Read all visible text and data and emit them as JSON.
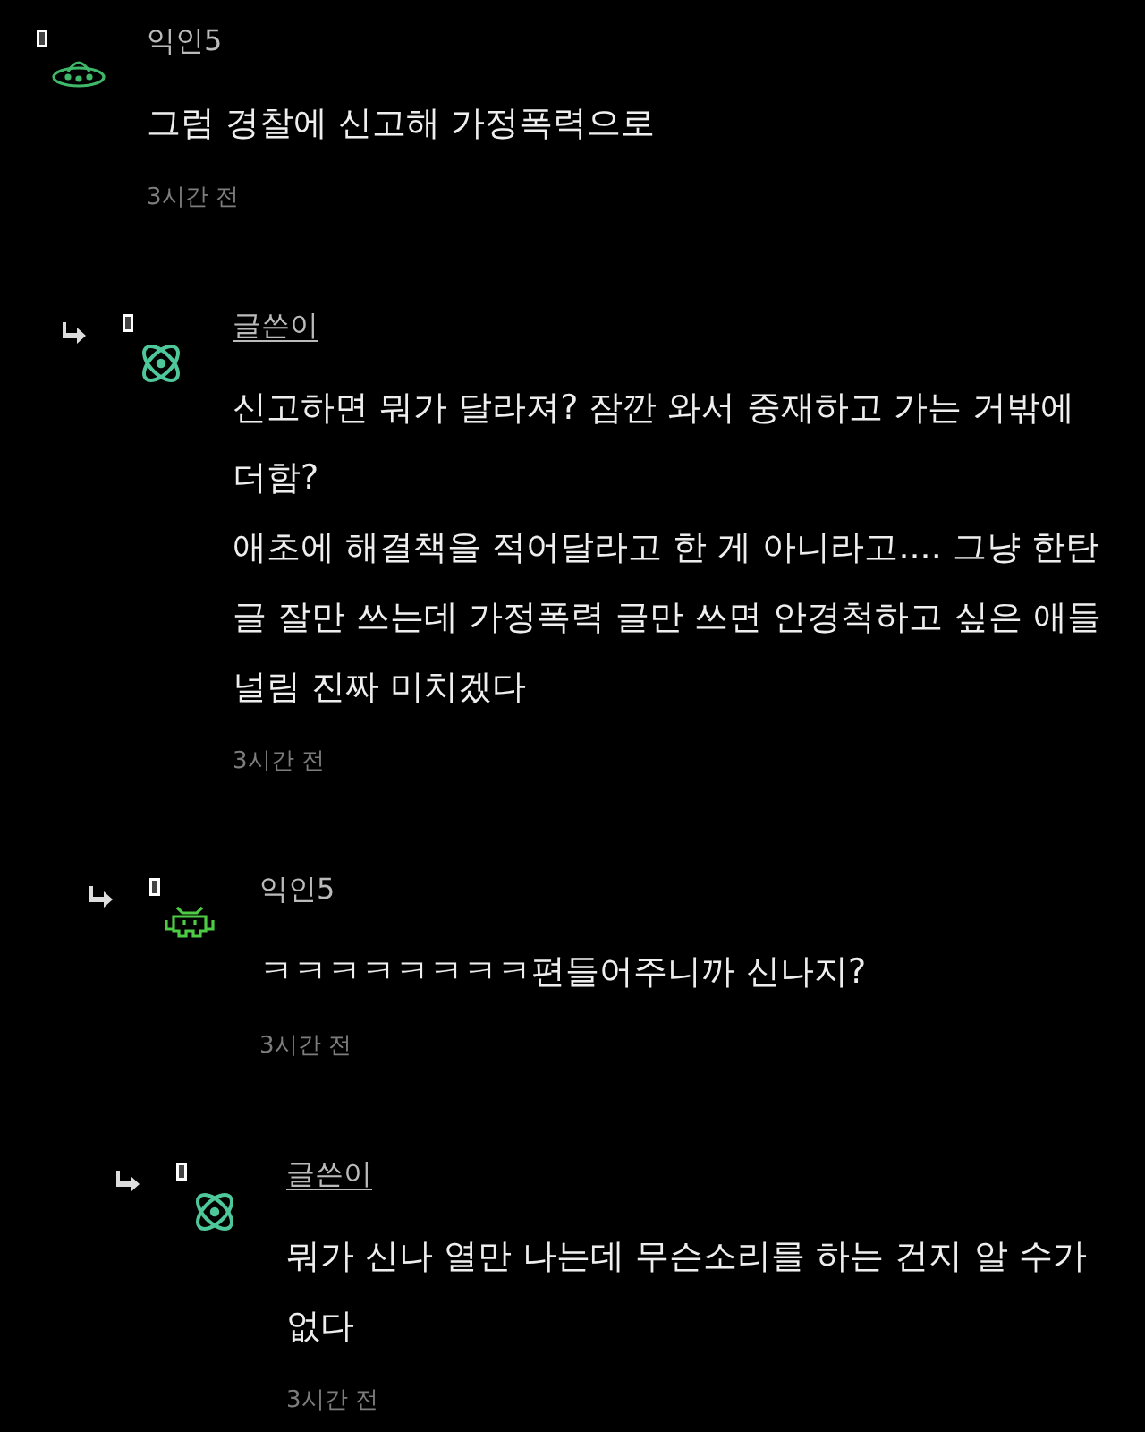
{
  "comments": [
    {
      "kind": "ufo",
      "name": "익인5",
      "author": false,
      "paragraphs": [
        "그럼 경찰에 신고해 가정폭력으로"
      ],
      "time": "3시간 전",
      "children": [
        {
          "kind": "atom",
          "name": "글쓴이",
          "author": true,
          "paragraphs": [
            "신고하면 뭐가 달라져? 잠깐 와서 중재하고 가는 거밖에 더함?",
            "애초에 해결책을 적어달라고 한 게 아니라고.... 그냥 한탄글 잘만 쓰는데 가정폭력 글만 쓰면 안경척하고 싶은 애들 널림 진짜 미치겠다"
          ],
          "time": "3시간 전",
          "children": [
            {
              "kind": "invader",
              "name": "익인5",
              "author": false,
              "paragraphs": [
                "ㅋㅋㅋㅋㅋㅋㅋㅋ편들어주니까 신나지?"
              ],
              "time": "3시간 전",
              "children": [
                {
                  "kind": "atom",
                  "name": "글쓴이",
                  "author": true,
                  "paragraphs": [
                    "뭐가 신나 열만 나는데 무슨소리를 하는 건지 알 수가 없다"
                  ],
                  "time": "3시간 전"
                }
              ]
            }
          ]
        }
      ]
    }
  ]
}
